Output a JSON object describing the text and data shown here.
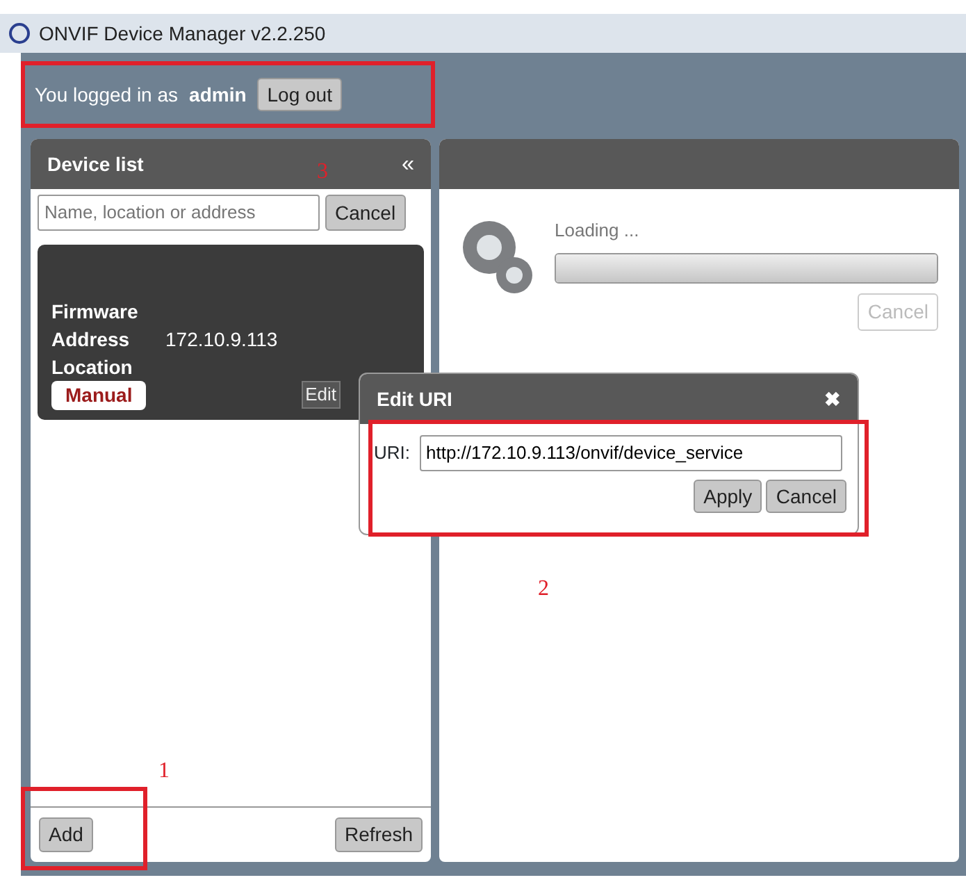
{
  "window": {
    "title": "ONVIF Device Manager v2.2.250"
  },
  "login": {
    "text": "You logged in as",
    "user": "admin",
    "button": "Log out"
  },
  "device_list": {
    "title": "Device list",
    "collapse": "«",
    "search": {
      "placeholder": "Name, location or address"
    },
    "search_button": "Cancel",
    "devices": [
      {
        "fields": [
          {
            "label": "Firmware"
          },
          {
            "label": "Address",
            "value": "172.10.9.113"
          },
          {
            "label": "Location"
          }
        ],
        "badge": "Manual",
        "buttons": [
          "Edit"
        ]
      }
    ],
    "add_button": "Add",
    "refresh_button": "Refresh"
  },
  "loading": {
    "text": "Loading ...",
    "level": 1,
    "cancel": {
      "label": "Cancel",
      "disabled": true
    }
  },
  "dialog": {
    "title": "Edit URI",
    "close": "✖",
    "field_label": "URI:",
    "value": "http://172.10.9.113/onvif/device_service",
    "buttons": [
      "Apply",
      "Cancel"
    ]
  },
  "annotations": [
    {
      "label": "3"
    },
    {
      "label": "2"
    },
    {
      "label": "1"
    }
  ]
}
